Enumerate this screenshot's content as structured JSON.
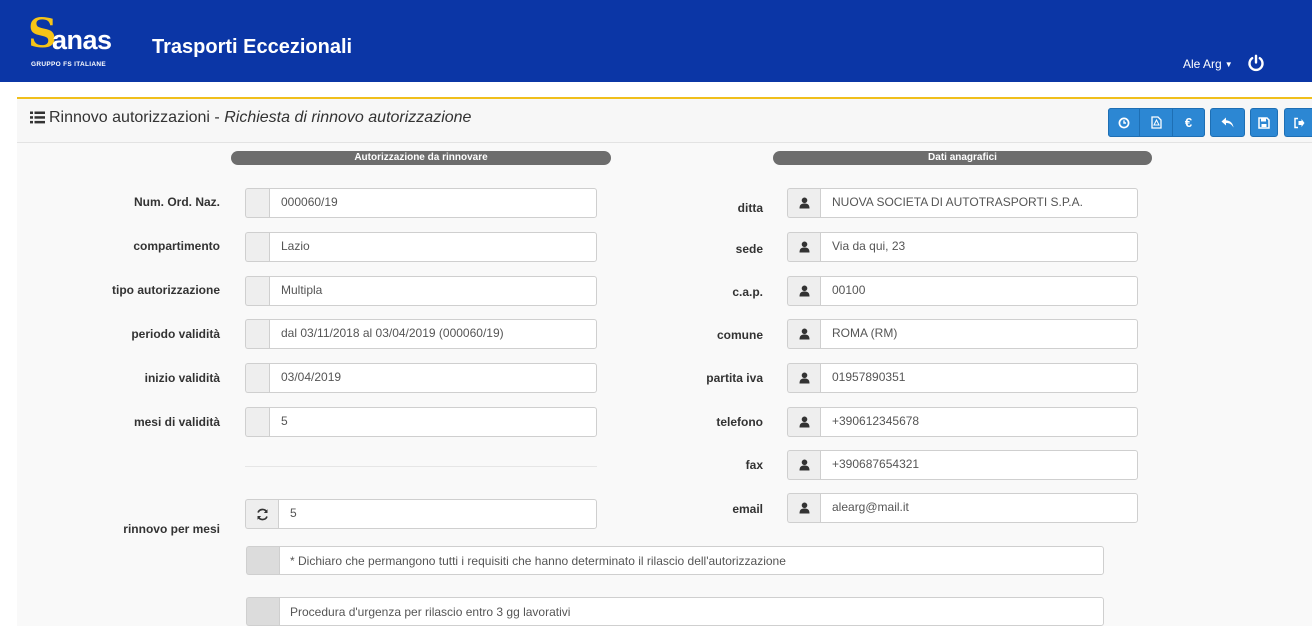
{
  "brand": {
    "name": "anas",
    "subtitle": "GRUPPO FS ITALIANE",
    "logo_color": "#f6c417"
  },
  "navbar": {
    "title": "Trasporti Eccezionali",
    "user": "Ale Arg",
    "background": "#0b36a6"
  },
  "page": {
    "section": "Rinnovo autorizzazioni",
    "separator": " - ",
    "subtitle": "Richiesta di rinnovo autorizzazione"
  },
  "toolbar": {
    "buttons": [
      {
        "name": "history",
        "icon": "clock-icon"
      },
      {
        "name": "pdf",
        "icon": "pdf-icon"
      },
      {
        "name": "payment",
        "icon": "euro-icon"
      },
      {
        "name": "back",
        "icon": "reply-icon"
      },
      {
        "name": "save",
        "icon": "save-icon"
      },
      {
        "name": "logout",
        "icon": "sign-out-icon"
      }
    ],
    "euro_symbol": "€",
    "color": "#2c87d3"
  },
  "left_section": {
    "title": "Autorizzazione da rinnovare",
    "fields": [
      {
        "label": "Num. Ord. Naz.",
        "value": "000060/19"
      },
      {
        "label": "compartimento",
        "value": "Lazio"
      },
      {
        "label": "tipo autorizzazione",
        "value": "Multipla"
      },
      {
        "label": "periodo validità",
        "value": "dal 03/11/2018 al 03/04/2019 (000060/19)"
      },
      {
        "label": "inizio validità",
        "value": "03/04/2019"
      },
      {
        "label": "mesi di validità",
        "value": "5"
      }
    ],
    "renewal": {
      "label": "rinnovo per mesi",
      "value": "5",
      "icon": "refresh-icon"
    }
  },
  "right_section": {
    "title": "Dati anagrafici",
    "fields": [
      {
        "label": "ditta",
        "value": "NUOVA SOCIETA DI AUTOTRASPORTI S.P.A."
      },
      {
        "label": "sede",
        "value": "Via da qui, 23"
      },
      {
        "label": "c.a.p.",
        "value": "00100"
      },
      {
        "label": "comune",
        "value": "ROMA (RM)"
      },
      {
        "label": "partita iva",
        "value": "01957890351"
      },
      {
        "label": "telefono",
        "value": "+390612345678"
      },
      {
        "label": "fax",
        "value": "+390687654321"
      },
      {
        "label": "email",
        "value": "alearg@mail.it"
      }
    ],
    "icon": "user-icon"
  },
  "checks": [
    {
      "text": "* Dichiaro che permangono tutti i requisiti che hanno determinato il rilascio dell'autorizzazione"
    },
    {
      "text": "Procedura d'urgenza per rilascio entro 3 gg lavorativi"
    }
  ]
}
